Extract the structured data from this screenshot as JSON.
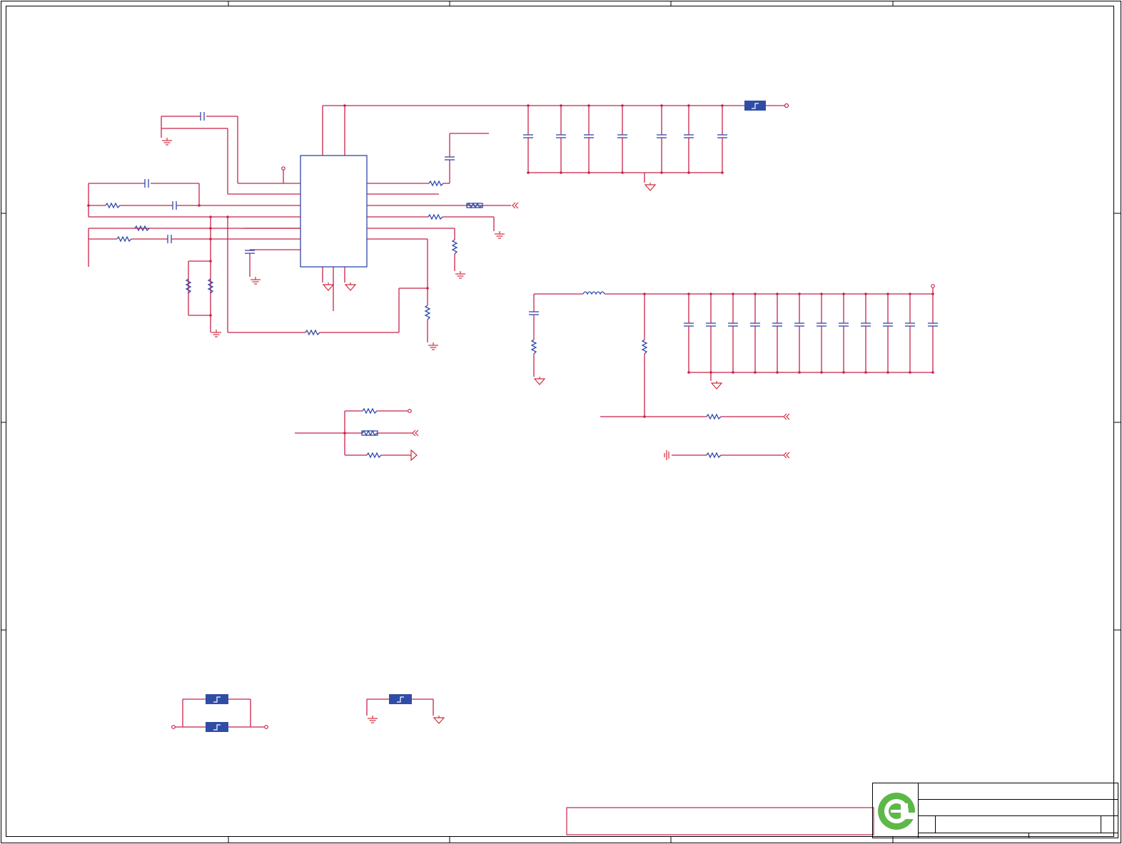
{
  "drawing": {
    "colors": {
      "wire": "#c8234a",
      "component": "#3048a8",
      "ground_symbol": "#d62a3a",
      "frame": "#000000",
      "fuse_fill": "#2f4da6",
      "logo_green": "#5db84a",
      "notice_box": "#c8234a"
    },
    "icons": [
      "logo-icon",
      "ground-icon",
      "signal-ground-icon",
      "chassis-ground-icon",
      "port-arrow-icon",
      "power-pin-icon"
    ],
    "title_block": {
      "logo": "logo-icon",
      "title": "",
      "document_number": "",
      "revision": "",
      "sheet": "",
      "date": ""
    },
    "notice_text": ""
  }
}
